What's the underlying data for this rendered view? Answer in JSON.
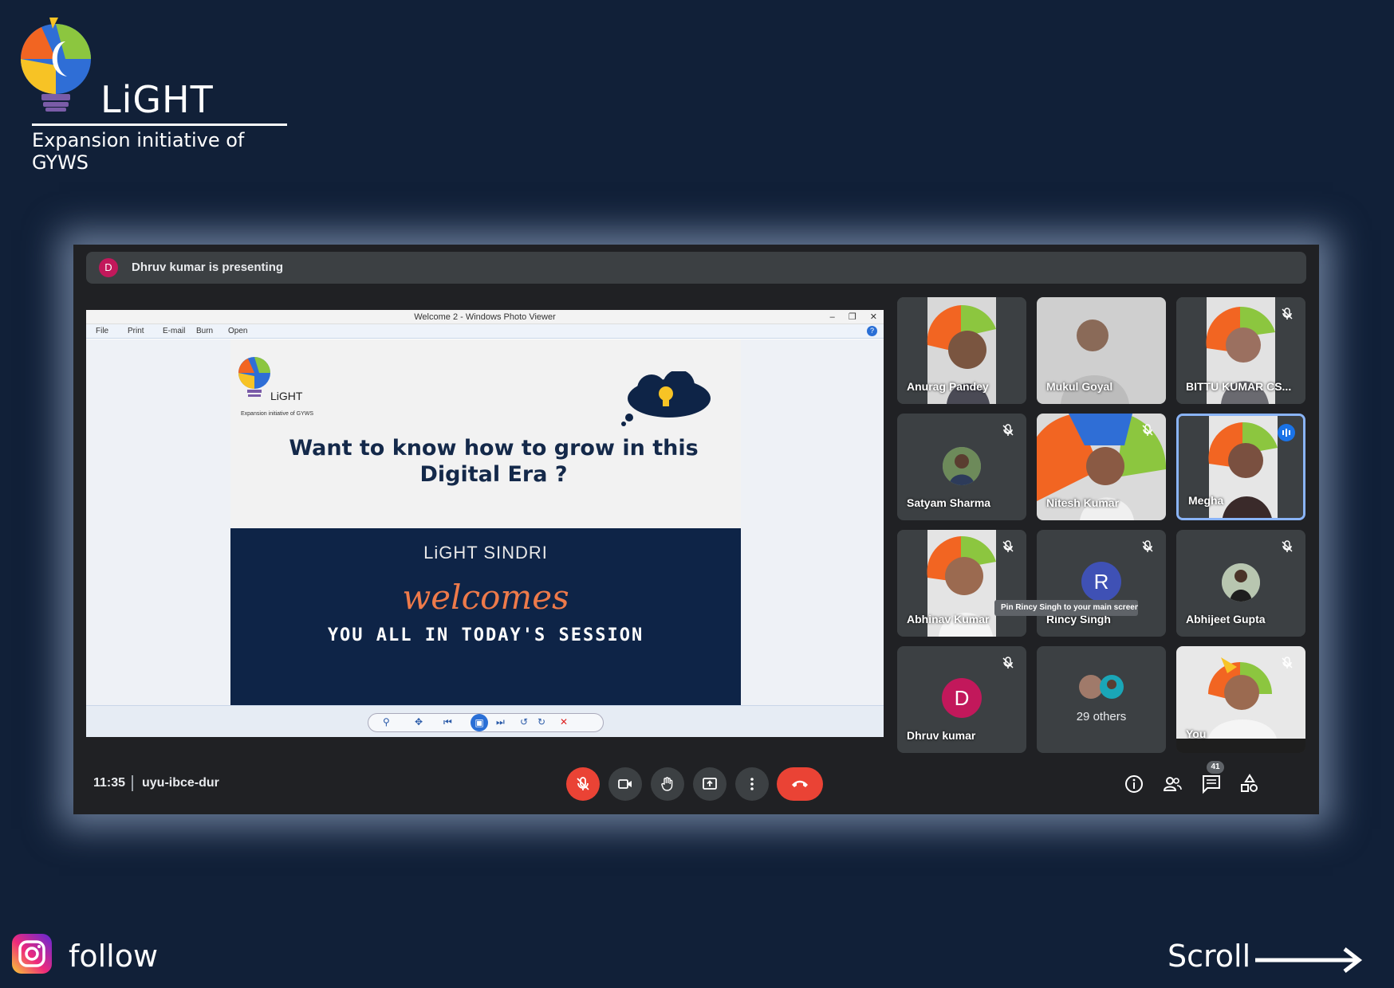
{
  "brand": {
    "name": "LiGHT",
    "tagline": "Expansion initiative of GYWS"
  },
  "meet": {
    "presenting_initial": "D",
    "presenting_text": "Dhruv kumar is presenting",
    "time": "11:35",
    "meeting_code": "uyu-ibce-dur",
    "participant_count": "41",
    "tooltip": "Pin Rincy Singh to your main screen.",
    "participants": [
      {
        "name": "Anurag Pandey",
        "muted": false
      },
      {
        "name": "Mukul Goyal",
        "muted": false
      },
      {
        "name": "BITTU KUMAR CS...",
        "muted": true
      },
      {
        "name": "Satyam Sharma",
        "muted": true
      },
      {
        "name": "Nitesh Kumar",
        "muted": true
      },
      {
        "name": "Megha",
        "muted": false,
        "speaking": true
      },
      {
        "name": "Abhinav Kumar",
        "muted": true
      },
      {
        "name": "Rincy Singh",
        "initial": "R",
        "muted": true
      },
      {
        "name": "Abhijeet Gupta",
        "muted": true
      },
      {
        "name": "Dhruv kumar",
        "initial": "D",
        "muted": true
      },
      {
        "name": "29 others"
      },
      {
        "name": "You",
        "muted": true
      }
    ]
  },
  "photo_viewer": {
    "title": "Welcome 2 - Windows Photo Viewer",
    "menu": [
      "File",
      "Print",
      "E-mail",
      "Burn",
      "Open"
    ]
  },
  "slide": {
    "brand": "LiGHT",
    "tagline": "Expansion initiative of GYWS",
    "question_line1": "Want to know how to grow in this",
    "question_line2": "Digital Era ?",
    "org": "LiGHT SINDRI",
    "welcome": "welcomes",
    "session": "YOU ALL IN TODAY'S SESSION"
  },
  "footer": {
    "follow": "follow",
    "scroll": "Scroll"
  },
  "colors": {
    "background": "#112038",
    "meet_bg": "#202124",
    "tile_bg": "#3c4043",
    "danger": "#ea4335",
    "accent": "#8ab4f8"
  }
}
